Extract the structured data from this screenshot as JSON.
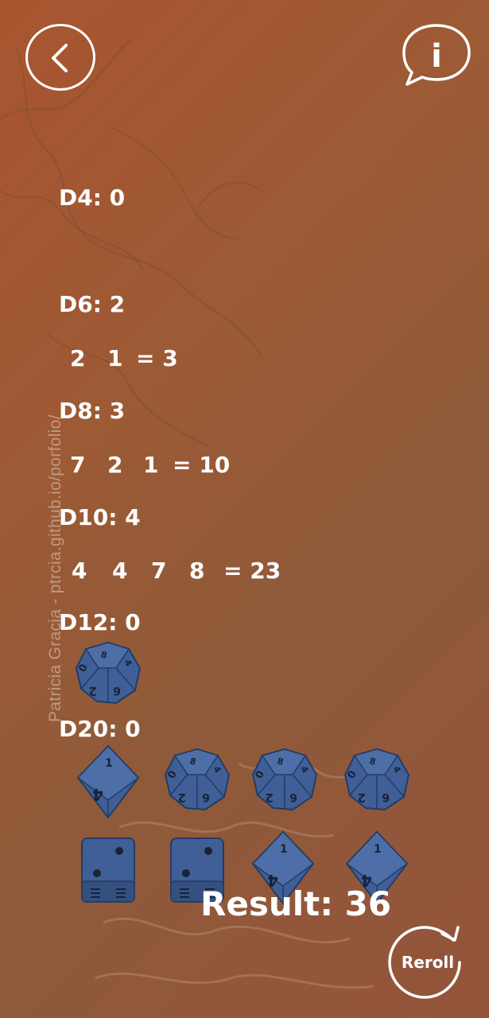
{
  "icons": {
    "back": "chevron-left-icon",
    "info": "info-speech-bubble-icon",
    "reroll": "circular-arrow-icon"
  },
  "colors": {
    "background": "#9c5a35",
    "text": "#ffffff",
    "die": "#3f5f96",
    "die_dark": "#2a4472"
  },
  "info": {
    "letter": "i"
  },
  "watermark": "Patricia Gracia - ptrcia.github.io/porfolio/",
  "dice_summary": {
    "d4": "D4: 0",
    "d6": "D6: 2",
    "d8": "D8: 3",
    "d10": "D10: 4",
    "d12": "D12: 0",
    "d20": "D20: 0"
  },
  "rolls": {
    "d6": [
      "2",
      "1",
      "= 3"
    ],
    "d8": [
      "7",
      "2",
      "1",
      "= 10"
    ],
    "d10": [
      "4",
      "4",
      "7",
      "8",
      "= 23"
    ]
  },
  "dice_faces": {
    "top_d10": {
      "a": "8",
      "b": "4",
      "c": "0",
      "d": "6",
      "e": "2"
    },
    "d20_d8a": {
      "top": "1",
      "bottom": "4"
    },
    "d20_d10": {
      "a": "8",
      "b": "4",
      "c": "0",
      "d": "6",
      "e": "2"
    }
  },
  "result": "Result: 36",
  "reroll_label": "Reroll"
}
